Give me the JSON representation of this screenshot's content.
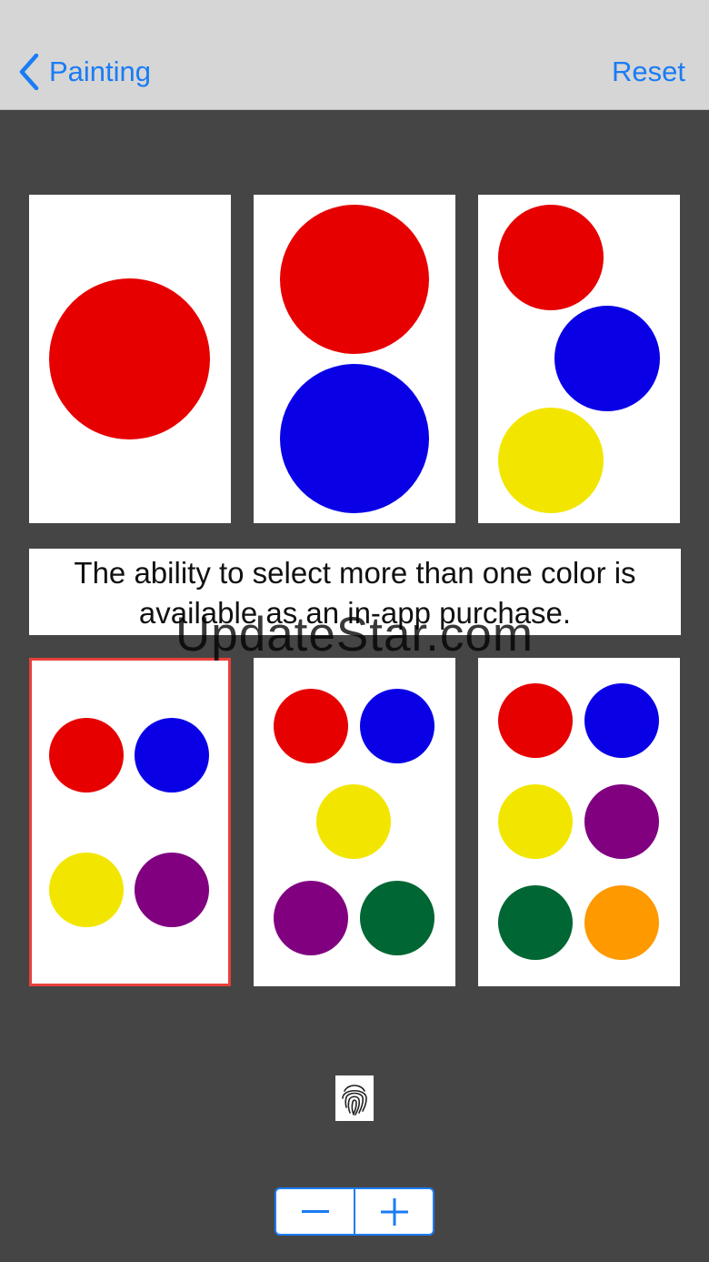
{
  "nav": {
    "back_label": "Painting",
    "reset_label": "Reset"
  },
  "notice": {
    "text": "The ability to select more than one color is available as an in-app purchase."
  },
  "watermark": "UpdateStar.com",
  "colors": {
    "red": "#e60000",
    "blue": "#0a00e6",
    "yellow": "#f2e600",
    "purple": "#800080",
    "green": "#006633",
    "orange": "#ff9900",
    "accent": "#1a7cf5",
    "selection": "#e8403a",
    "background": "#454545",
    "navbar": "#d6d6d6"
  },
  "layouts": [
    {
      "count": 1,
      "selected": false,
      "colors": [
        "red"
      ]
    },
    {
      "count": 2,
      "selected": false,
      "colors": [
        "red",
        "blue"
      ]
    },
    {
      "count": 3,
      "selected": false,
      "colors": [
        "red",
        "blue",
        "yellow"
      ]
    },
    {
      "count": 4,
      "selected": true,
      "colors": [
        "red",
        "blue",
        "yellow",
        "purple"
      ]
    },
    {
      "count": 5,
      "selected": false,
      "colors": [
        "red",
        "blue",
        "yellow",
        "purple",
        "green"
      ]
    },
    {
      "count": 6,
      "selected": false,
      "colors": [
        "red",
        "blue",
        "yellow",
        "purple",
        "green",
        "orange"
      ]
    }
  ],
  "icons": {
    "back": "chevron-left-icon",
    "fingerprint": "fingerprint-icon",
    "minus": "minus-icon",
    "plus": "plus-icon"
  }
}
